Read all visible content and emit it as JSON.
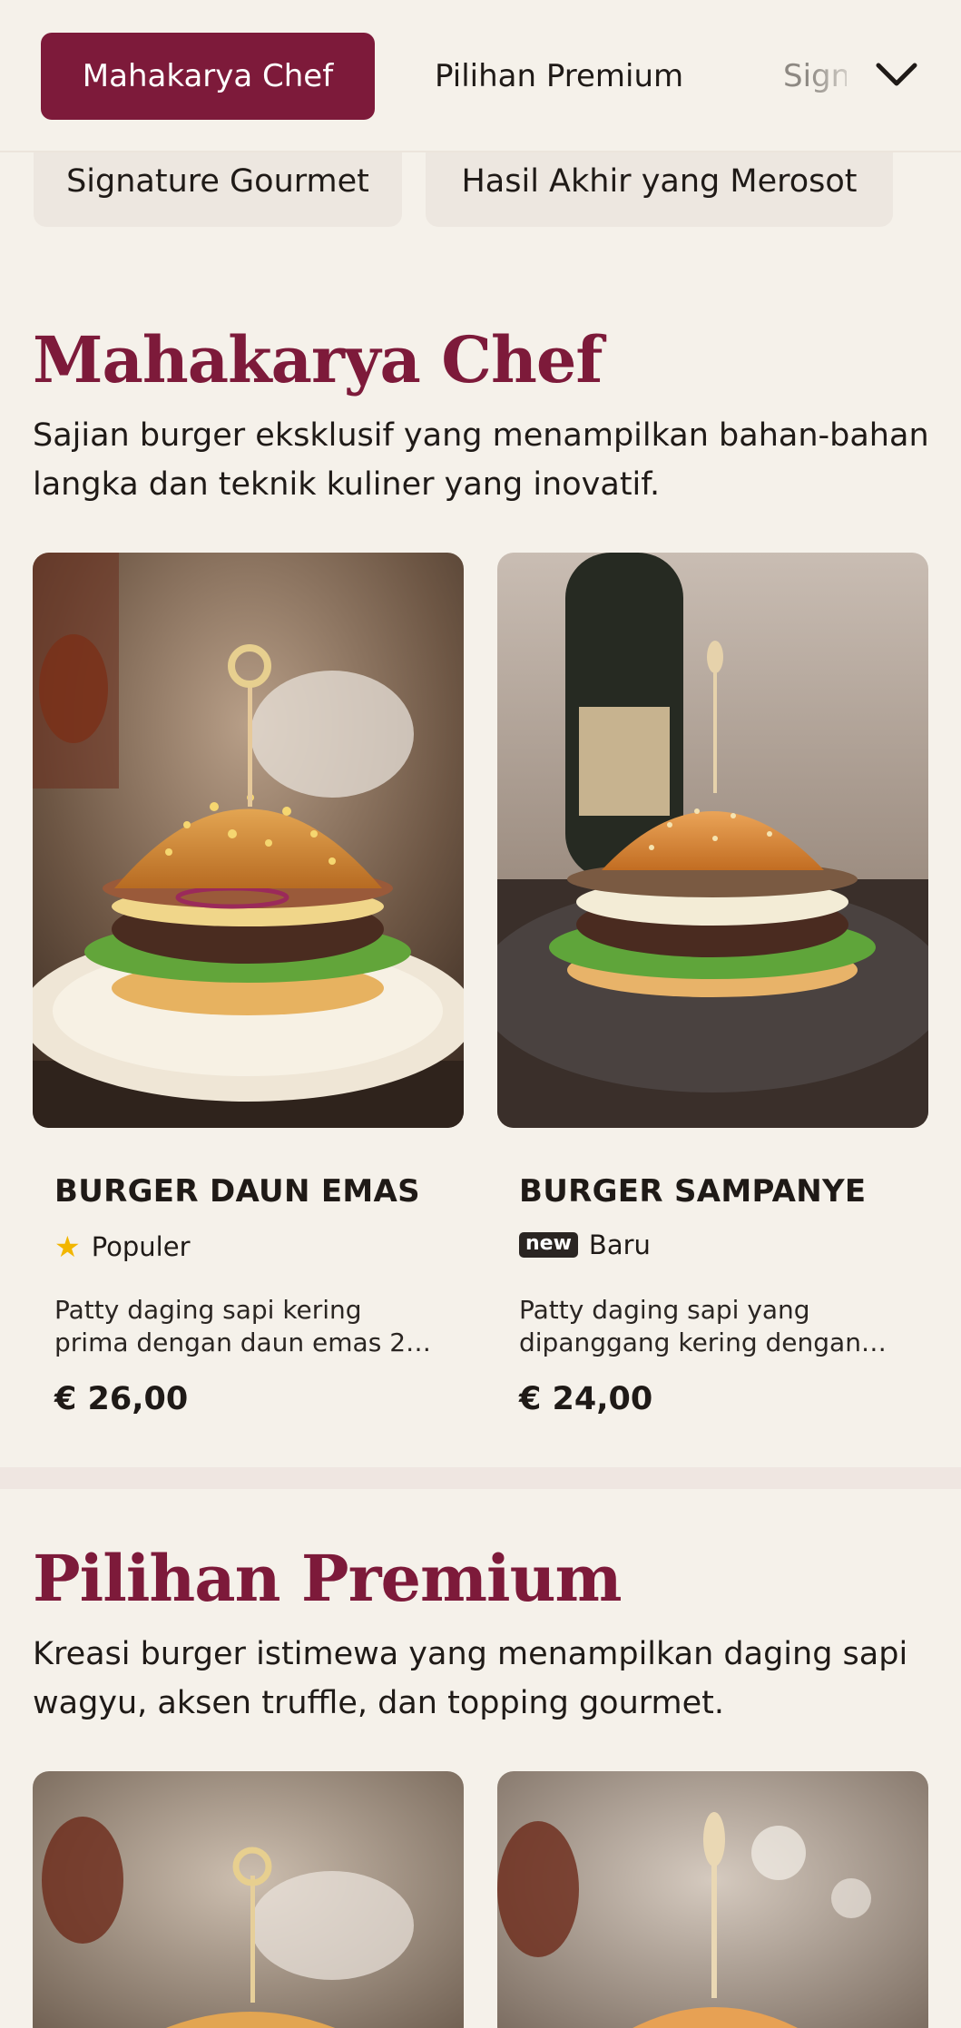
{
  "category_bar": {
    "tabs": [
      {
        "label": "Mahakarya Chef",
        "active": true
      },
      {
        "label": "Pilihan Premium",
        "active": false
      },
      {
        "label": "Signature Gourmet",
        "active": false
      }
    ],
    "expand_icon": "chevron-down-icon"
  },
  "chips": [
    {
      "label": "Signature Gourmet"
    },
    {
      "label": "Hasil Akhir yang Merosot"
    }
  ],
  "sections": [
    {
      "title": "Mahakarya Chef",
      "description": "Sajian burger eksklusif yang menampilkan bahan-bahan langka dan teknik kuliner yang inovatif.",
      "items": [
        {
          "name": "BURGER DAUN EMAS",
          "tag": "Populer",
          "tag_icon": "star-icon",
          "description": "Patty daging sapi kering prima dengan daun emas 2…",
          "price": "€ 26,00"
        },
        {
          "name": "BURGER SAMPANYE",
          "tag": "Baru",
          "tag_badge": "new",
          "description": "Patty daging sapi yang dipanggang kering dengan…",
          "price": "€ 24,00"
        }
      ]
    },
    {
      "title": "Pilihan Premium",
      "description": "Kreasi burger istimewa yang menampilkan daging sapi wagyu, aksen truffle, dan topping gourmet."
    }
  ],
  "colors": {
    "brand": "#7d1a3a",
    "background": "#f5f1ea",
    "star": "#f2b600"
  }
}
